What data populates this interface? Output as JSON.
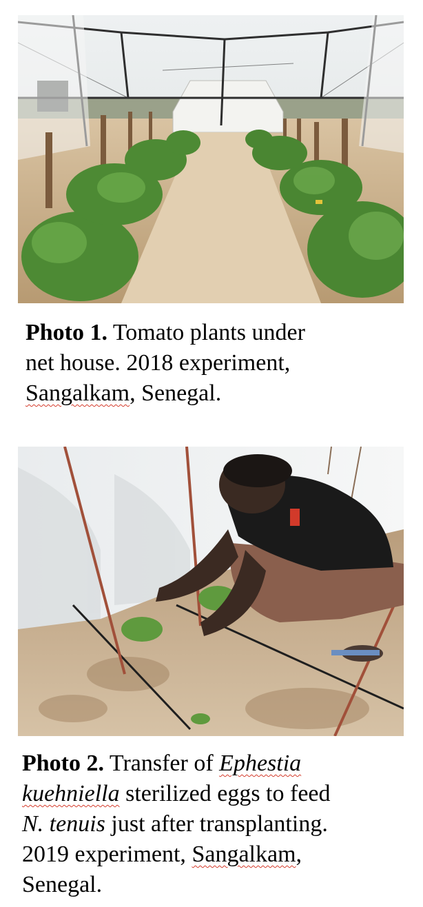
{
  "photo1": {
    "caption": {
      "label": "Photo 1.",
      "line1": "Tomato plants under",
      "line2": "net house. 2018 experiment,",
      "place": "Sangalkam",
      "rest": ", Senegal."
    }
  },
  "photo2": {
    "caption": {
      "label": "Photo 2.",
      "line1_pre": "Transfer of",
      "genus": "Ephestia",
      "species": "kuehniella",
      "line2_rest": "sterilized eggs to feed",
      "predator": "N. tenuis",
      "line3_rest": "just after transplanting.",
      "line4_pre": "2019 experiment,",
      "place": "Sangalkam",
      "place_comma": ",",
      "country": "Senegal."
    }
  }
}
